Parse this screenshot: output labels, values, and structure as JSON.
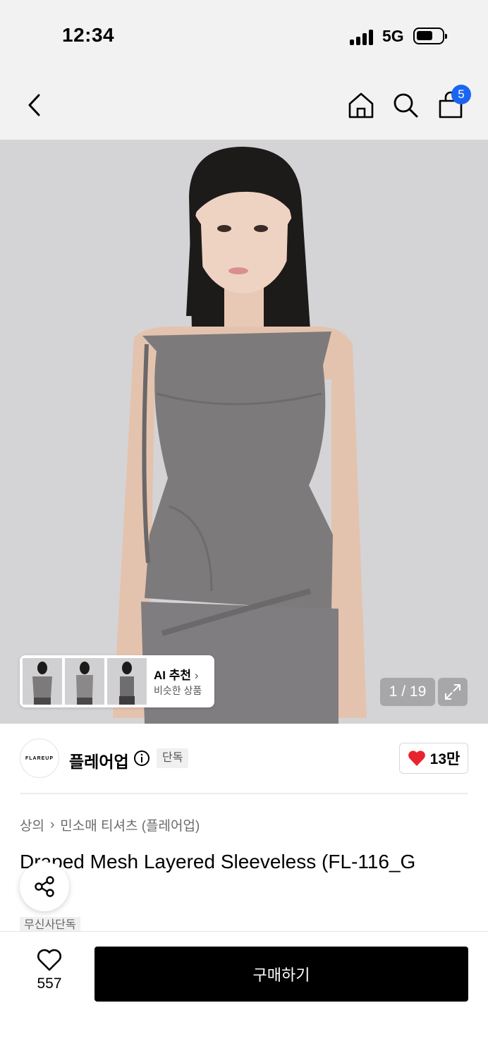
{
  "status_bar": {
    "time": "12:34",
    "network": "5G"
  },
  "nav": {
    "back_icon": "chevron-left-icon",
    "home_icon": "home-icon",
    "search_icon": "search-icon",
    "cart_icon": "shopping-bag-icon",
    "cart_count": "5"
  },
  "gallery": {
    "ai_reco_title": "AI 추천",
    "ai_reco_subtitle": "비슷한 상품",
    "counter": "1 / 19"
  },
  "brand": {
    "logo_text": "FLAREUP",
    "name": "플레어업",
    "exclusive": "단독",
    "likes": "13만"
  },
  "breadcrumb": {
    "category": "상의",
    "subcategory": "민소매 티셔츠 (플레어업)"
  },
  "product": {
    "title": "Draped Mesh Layered Sleeveless (FL-116_G",
    "musinsa_badge": "무신사단독"
  },
  "bottom_bar": {
    "wish_count": "557",
    "buy_label": "구매하기"
  },
  "colors": {
    "accent_blue": "#1b66f0",
    "heart_red": "#e8242f",
    "buy_black": "#000000"
  }
}
